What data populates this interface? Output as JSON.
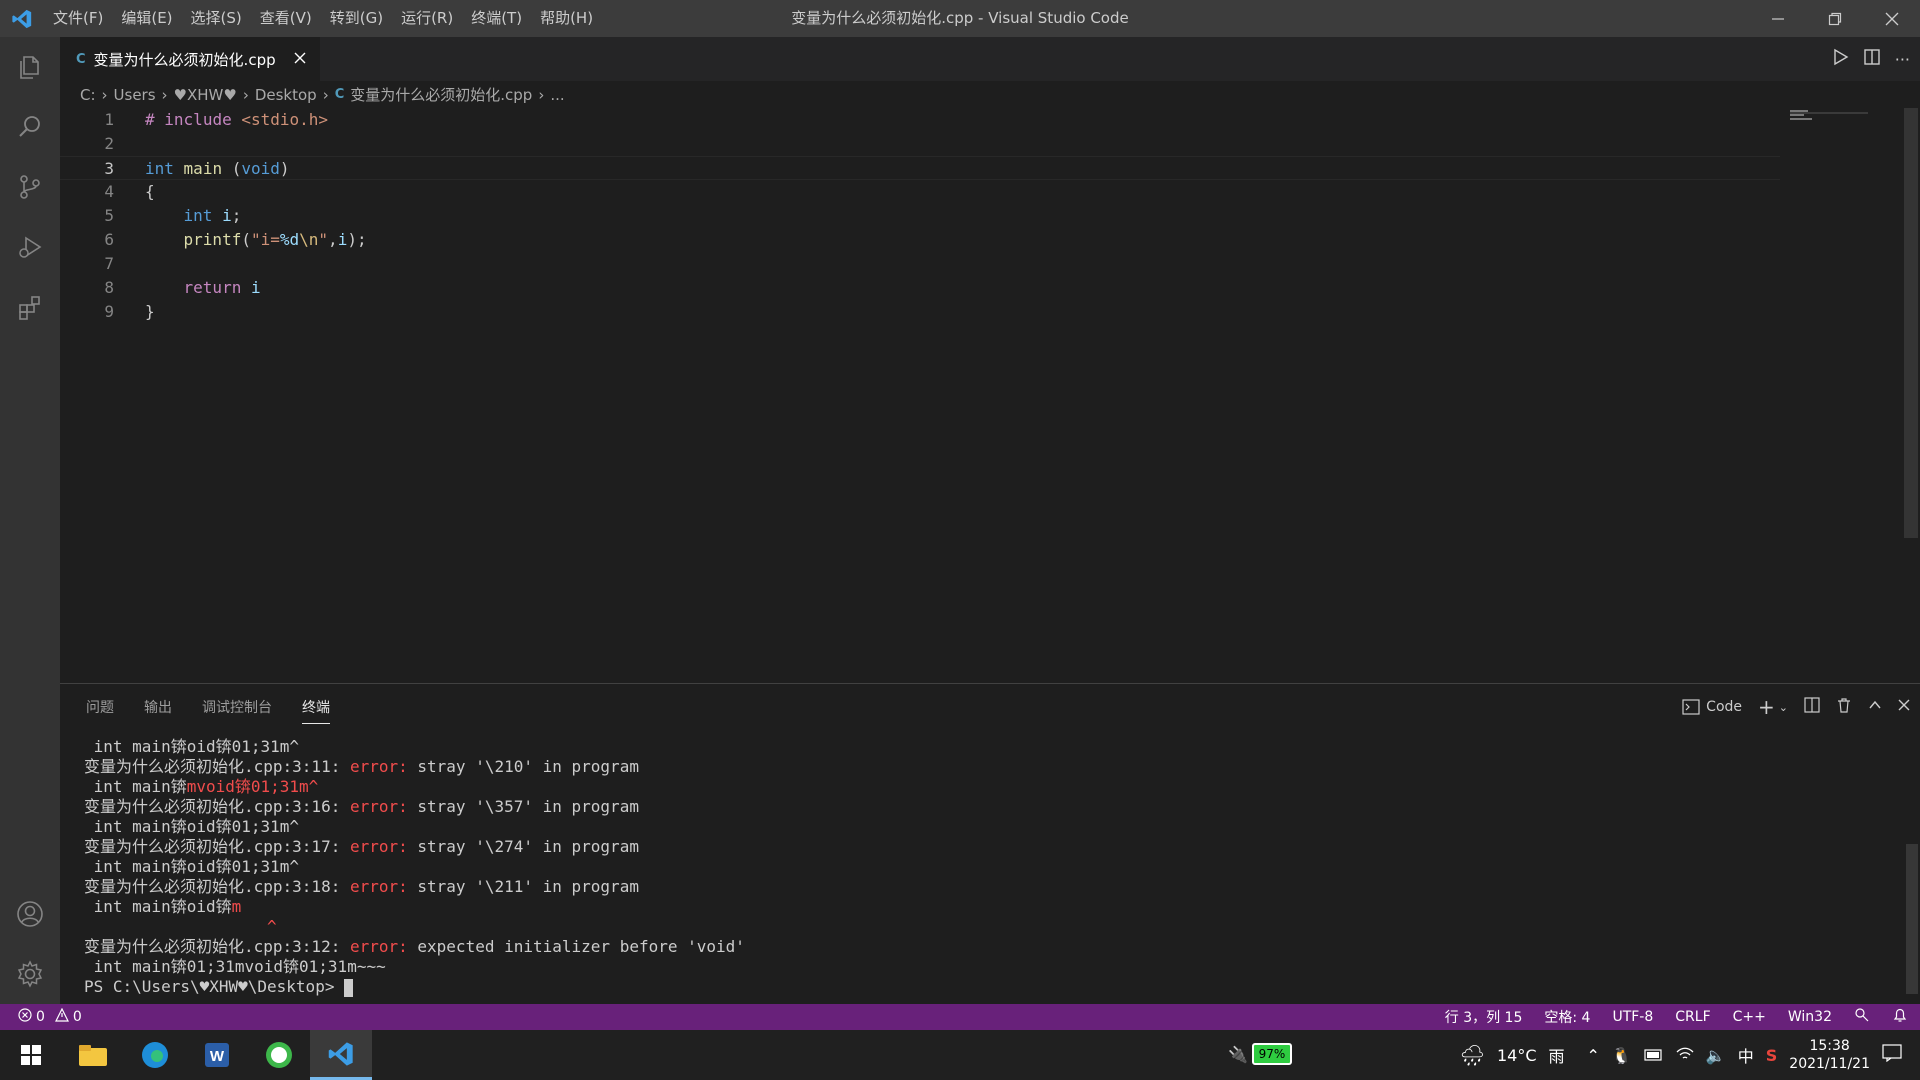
{
  "window": {
    "title": "变量为什么必须初始化.cpp - Visual Studio Code",
    "menu": [
      "文件(F)",
      "编辑(E)",
      "选择(S)",
      "查看(V)",
      "转到(G)",
      "运行(R)",
      "终端(T)",
      "帮助(H)"
    ]
  },
  "tab": {
    "label": "变量为什么必须初始化.cpp",
    "icon": "cpp-file-icon"
  },
  "breadcrumb": [
    "C:",
    "Users",
    "♥XHW♥",
    "Desktop",
    "变量为什么必须初始化.cpp",
    "..."
  ],
  "code": {
    "line_numbers": [
      "1",
      "2",
      "3",
      "4",
      "5",
      "6",
      "7",
      "8",
      "9"
    ],
    "current_line": 3
  },
  "panel": {
    "tabs": [
      "问题",
      "输出",
      "调试控制台",
      "终端"
    ],
    "active_tab": "终端",
    "shell_label": "Code",
    "terminal": {
      "l1": " int main锛oid锛01;31m^",
      "l2_prefix": "变量为什么必须初始化.cpp:3:11: ",
      "l2_err": "error:",
      "l2_msg": " stray '\\210' in program",
      "l3a": " int main锛",
      "l3b": "mvoid锛01;31m^",
      "l4_prefix": "变量为什么必须初始化.cpp:3:16: ",
      "l4_err": "error:",
      "l4_msg": " stray '\\357' in program",
      "l5": " int main锛oid锛01;31m^",
      "l6_prefix": "变量为什么必须初始化.cpp:3:17: ",
      "l6_err": "error:",
      "l6_msg": " stray '\\274' in program",
      "l7": " int main锛oid锛01;31m^",
      "l8_prefix": "变量为什么必须初始化.cpp:3:18: ",
      "l8_err": "error:",
      "l8_msg": " stray '\\211' in program",
      "l9a": " int main锛oid锛",
      "l9b": "m",
      "l10": "                   ^",
      "l11_prefix": "变量为什么必须初始化.cpp:3:12: ",
      "l11_err": "error:",
      "l11_msg": " expected initializer before 'void'",
      "l12": " int main锛01;31mvoid锛01;31m~~~",
      "prompt": "PS C:\\Users\\♥XHW♥\\Desktop> "
    }
  },
  "status": {
    "errors": "0",
    "warnings": "0",
    "position": "行 3，列 15",
    "spaces": "空格: 4",
    "encoding": "UTF-8",
    "eol": "CRLF",
    "language": "C++",
    "platform": "Win32"
  },
  "taskbar": {
    "battery": "97%",
    "temperature": "14°C",
    "weather": "雨",
    "ime": "中",
    "time": "15:38",
    "date": "2021/11/21"
  },
  "colors": {
    "statusbar": "#68217a",
    "activitybar": "#333333",
    "editor": "#1e1e1e",
    "error": "#f14c4c"
  }
}
